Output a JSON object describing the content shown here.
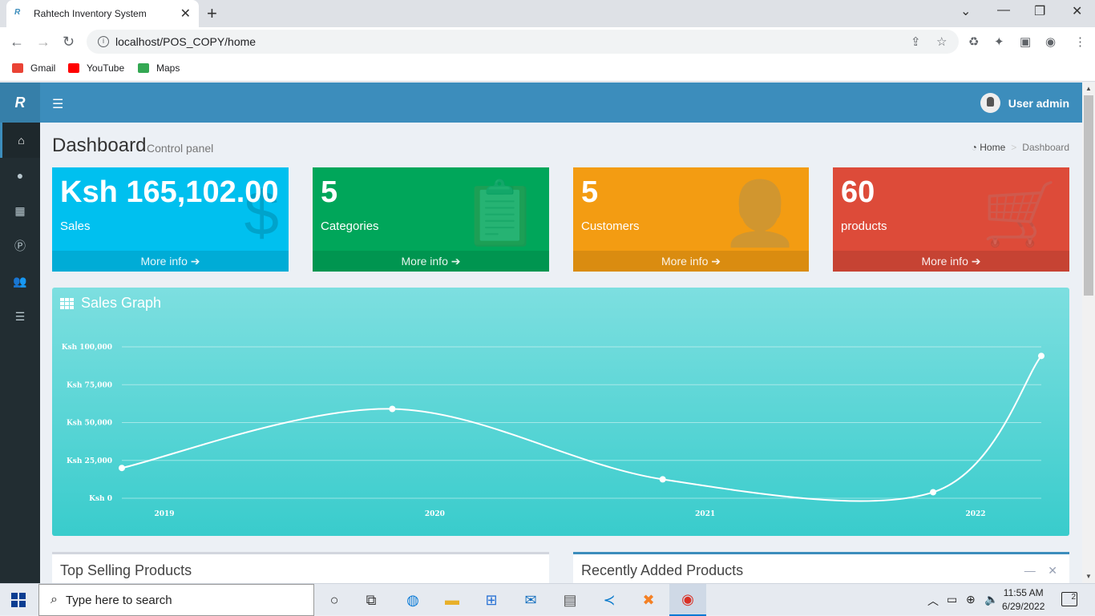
{
  "browser": {
    "tab_title": "Rahtech Inventory System",
    "url": "localhost/POS_COPY/home",
    "bookmarks": [
      {
        "label": "Gmail",
        "color": "#ea4335"
      },
      {
        "label": "YouTube",
        "color": "#ff0000"
      },
      {
        "label": "Maps",
        "color": "#34a853"
      }
    ]
  },
  "header": {
    "logo": "R",
    "user_label": "User admin"
  },
  "sidebar": {
    "items": [
      {
        "icon": "home-icon",
        "glyph": "⌂"
      },
      {
        "icon": "user-icon",
        "glyph": "●"
      },
      {
        "icon": "grid-icon",
        "glyph": "▦"
      },
      {
        "icon": "p-circle-icon",
        "glyph": "Ⓟ"
      },
      {
        "icon": "users-icon",
        "glyph": "👥"
      },
      {
        "icon": "list-icon",
        "glyph": "☰"
      }
    ]
  },
  "page": {
    "title": "Dashboard",
    "subtitle": "Control panel",
    "breadcrumb_home": "Home",
    "breadcrumb_current": "Dashboard"
  },
  "stats": [
    {
      "value": "Ksh 165,102.00",
      "label": "Sales",
      "more": "More info ➔",
      "color": "#00c0ef",
      "icon": "dollar-icon",
      "glyph": "$"
    },
    {
      "value": "5",
      "label": "Categories",
      "more": "More info ➔",
      "color": "#00a65a",
      "icon": "clipboard-icon",
      "glyph": "📋"
    },
    {
      "value": "5",
      "label": "Customers",
      "more": "More info ➔",
      "color": "#f39c12",
      "icon": "user-plus-icon",
      "glyph": "👤"
    },
    {
      "value": "60",
      "label": "products",
      "more": "More info ➔",
      "color": "#dd4b39",
      "icon": "cart-icon",
      "glyph": "🛒"
    }
  ],
  "graph": {
    "title": "Sales Graph"
  },
  "chart_data": {
    "type": "line",
    "x": [
      "2019",
      "2019.5",
      "2020.5",
      "2021.5",
      "2022.4"
    ],
    "xticks": [
      "2019",
      "2020",
      "2021",
      "2022"
    ],
    "points": [
      {
        "x": 2019.0,
        "y": 20000
      },
      {
        "x": 2020.0,
        "y": 59000
      },
      {
        "x": 2021.0,
        "y": 12500
      },
      {
        "x": 2022.0,
        "y": 4000
      },
      {
        "x": 2022.4,
        "y": 94000
      }
    ],
    "yticks": [
      "Ksh 0",
      "Ksh 25,000",
      "Ksh 50,000",
      "Ksh 75,000",
      "Ksh 100,000"
    ],
    "ylim": [
      0,
      100000
    ],
    "grid": true,
    "line_color": "#ffffff"
  },
  "panels": {
    "top_selling": "Top Selling Products",
    "recent": "Recently Added Products"
  },
  "taskbar": {
    "search_placeholder": "Type here to search",
    "time": "11:55 AM",
    "date": "6/29/2022",
    "notifications": "2"
  }
}
